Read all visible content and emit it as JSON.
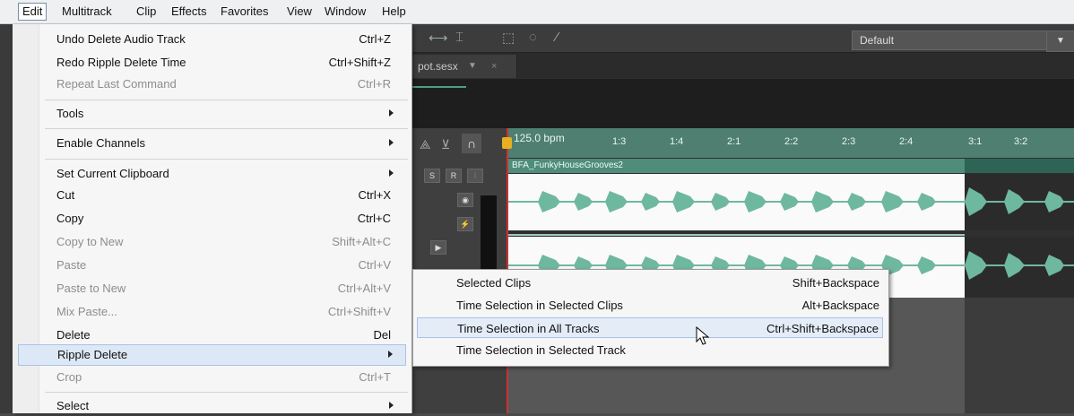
{
  "menubar": {
    "items": [
      "Edit",
      "Multitrack",
      "Clip",
      "Effects",
      "Favorites",
      "View",
      "Window",
      "Help"
    ]
  },
  "toolbar": {
    "preset": "Default",
    "icons": [
      "time-selection-icon",
      "marquee-icon",
      "lasso-icon",
      "brush-icon",
      "spot-healing-icon"
    ]
  },
  "tab": {
    "filename": "pot.sesx",
    "close": "×"
  },
  "ruler": {
    "bpm": "125.0 bpm",
    "ticks": [
      "1:3",
      "1:4",
      "2:1",
      "2:2",
      "2:3",
      "2:4",
      "3:1",
      "3:2"
    ]
  },
  "track": {
    "clip_name": "BFA_FunkyHouseGrooves2",
    "buttons": [
      "S",
      "R",
      "I"
    ],
    "color": "#4f8c79"
  },
  "edit_menu": {
    "undo": {
      "label": "Undo Delete Audio Track",
      "shortcut": "Ctrl+Z"
    },
    "redo": {
      "label": "Redo Ripple Delete Time",
      "shortcut": "Ctrl+Shift+Z"
    },
    "repeat": {
      "label": "Repeat Last Command",
      "shortcut": "Ctrl+R"
    },
    "tools": {
      "label": "Tools"
    },
    "enable_channels": {
      "label": "Enable Channels"
    },
    "set_clipboard": {
      "label": "Set Current Clipboard"
    },
    "cut": {
      "label": "Cut",
      "shortcut": "Ctrl+X"
    },
    "copy": {
      "label": "Copy",
      "shortcut": "Ctrl+C"
    },
    "copy_to_new": {
      "label": "Copy to New",
      "shortcut": "Shift+Alt+C"
    },
    "paste": {
      "label": "Paste",
      "shortcut": "Ctrl+V"
    },
    "paste_to_new": {
      "label": "Paste to New",
      "shortcut": "Ctrl+Alt+V"
    },
    "mix_paste": {
      "label": "Mix Paste...",
      "shortcut": "Ctrl+Shift+V"
    },
    "delete": {
      "label": "Delete",
      "shortcut": "Del"
    },
    "ripple_delete": {
      "label": "Ripple Delete"
    },
    "crop": {
      "label": "Crop",
      "shortcut": "Ctrl+T"
    },
    "select": {
      "label": "Select"
    }
  },
  "ripple_submenu": {
    "selected_clips": {
      "label": "Selected Clips",
      "shortcut": "Shift+Backspace"
    },
    "time_sel_selected_clips": {
      "label": "Time Selection in Selected Clips",
      "shortcut": "Alt+Backspace"
    },
    "time_sel_all_tracks": {
      "label": "Time Selection in All Tracks",
      "shortcut": "Ctrl+Shift+Backspace"
    },
    "time_sel_selected_track": {
      "label": "Time Selection in Selected Track"
    }
  }
}
